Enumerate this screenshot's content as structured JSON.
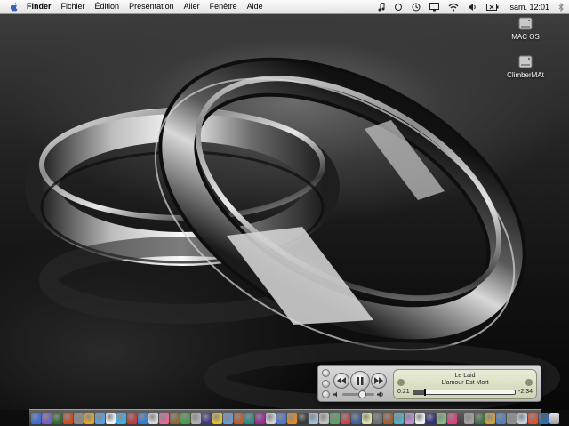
{
  "menubar": {
    "apple_icon": "apple-logo-icon",
    "items": [
      "Finder",
      "Fichier",
      "Édition",
      "Présentation",
      "Aller",
      "Fenêtre",
      "Aide"
    ],
    "status_icons": [
      "music-note-icon",
      "sync-icon",
      "time-machine-icon",
      "display-icon",
      "wifi-icon",
      "volume-icon",
      "battery-icon"
    ],
    "clock": "sam. 12:01",
    "spotlight_icon": "bluetooth-icon"
  },
  "desktop": {
    "drives": [
      {
        "label": "MAC OS",
        "icon": "hard-drive-icon"
      },
      {
        "label": "ClimberMAt",
        "icon": "hard-drive-icon"
      }
    ]
  },
  "mini_player": {
    "song_title": "Le Laid",
    "song_detail": "L'amour Est Mort",
    "elapsed": "0:21",
    "remaining": "-2:34",
    "progress": 0.12,
    "volume": 0.6,
    "buttons": [
      "previous-icon",
      "pause-icon",
      "next-icon"
    ]
  },
  "dock": {
    "colors": [
      "#3a6fd8",
      "#7a5cc9",
      "#2b6e2b",
      "#d24a1f",
      "#888",
      "#e0a52a",
      "#5aa0e0",
      "#f0f0f0",
      "#3cb0e8",
      "#c03a3a",
      "#2f7fd8",
      "#d8d8d8",
      "#e06a9a",
      "#8a6a3a",
      "#45a045",
      "#b0b0b0",
      "#3a3a8a",
      "#e0c030",
      "#6a9ad0",
      "#c05a2a",
      "#2a8a8a",
      "#9a2a9a",
      "#d0d0d0",
      "#4a7ad0",
      "#e08a2a",
      "#3a3a3a",
      "#a0c0e0",
      "#c0c0c0",
      "#60a060",
      "#d04040",
      "#4060a0",
      "#e0e0a0",
      "#707070",
      "#a06030",
      "#50b0d0",
      "#c090e0",
      "#f0f0f0",
      "#303080",
      "#80c080",
      "#e04080",
      "#a0a0a0",
      "#407040",
      "#d0a040",
      "#5080c0",
      "#909090",
      "#c0d0e0",
      "#e05030",
      "#3070b0"
    ],
    "trash_icon": "trash-icon"
  }
}
